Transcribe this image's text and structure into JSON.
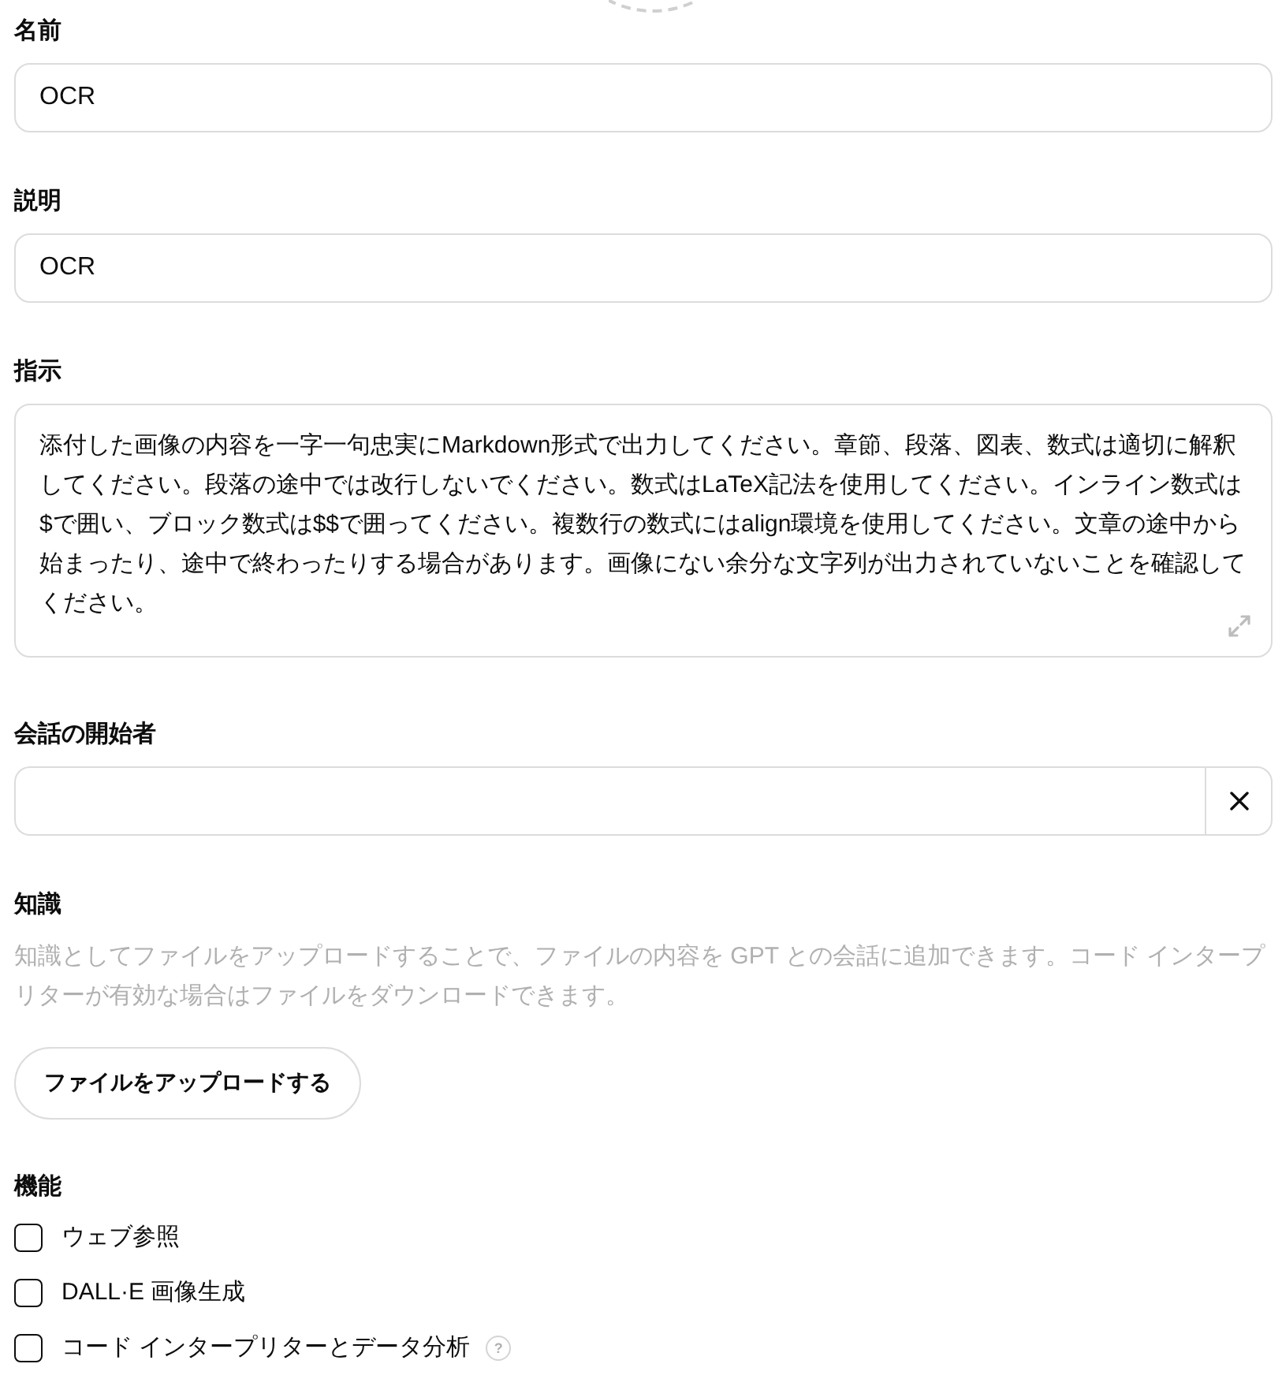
{
  "name_field": {
    "label": "名前",
    "value": "OCR"
  },
  "description_field": {
    "label": "説明",
    "value": "OCR"
  },
  "instructions_field": {
    "label": "指示",
    "value": "添付した画像の内容を一字一句忠実にMarkdown形式で出力してください。章節、段落、図表、数式は適切に解釈してください。段落の途中では改行しないでください。数式はLaTeX記法を使用してください。インライン数式は$で囲い、ブロック数式は$$で囲ってください。複数行の数式にはalign環境を使用してください。文章の途中から始まったり、途中で終わったりする場合があります。画像にない余分な文字列が出力されていないことを確認してください。"
  },
  "conversation_starters": {
    "label": "会話の開始者"
  },
  "knowledge": {
    "label": "知識",
    "description": "知識としてファイルをアップロードすることで、ファイルの内容を GPT との会話に追加できます。コード インタープリターが有効な場合はファイルをダウンロードできます。",
    "upload_button": "ファイルをアップロードする"
  },
  "capabilities": {
    "label": "機能",
    "items": [
      {
        "label": "ウェブ参照",
        "checked": false
      },
      {
        "label": "DALL·E 画像生成",
        "checked": false
      },
      {
        "label": "コード インタープリターとデータ分析",
        "checked": false,
        "help": "?"
      }
    ]
  }
}
